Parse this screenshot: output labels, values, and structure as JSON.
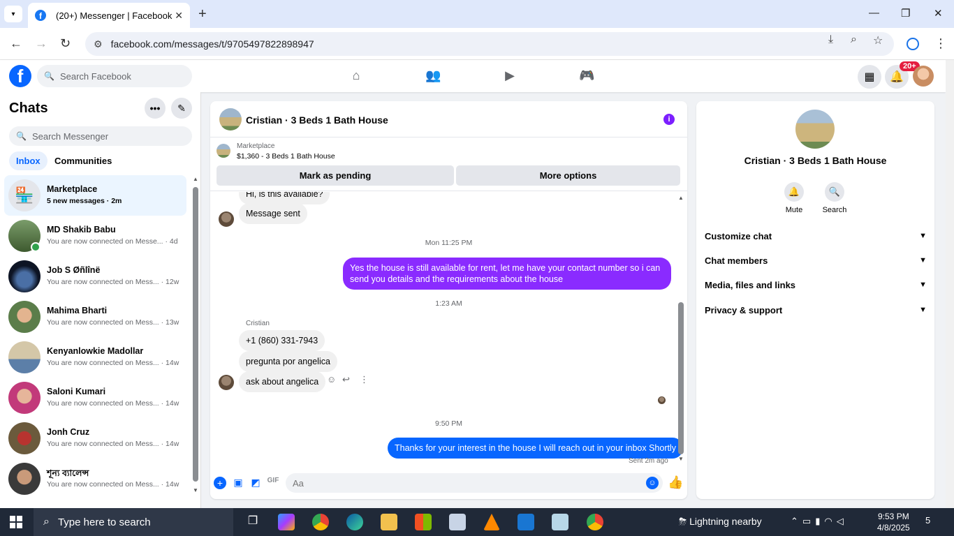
{
  "browser": {
    "tab_title": "(20+) Messenger | Facebook",
    "url": "facebook.com/messages/t/9705497822898947"
  },
  "header": {
    "search_placeholder": "Search Facebook",
    "notification_badge": "20+"
  },
  "sidebar": {
    "title": "Chats",
    "search_placeholder": "Search Messenger",
    "tabs": [
      "Inbox",
      "Communities"
    ],
    "chats": [
      {
        "name": "Marketplace",
        "preview": "5 new messages · 2m"
      },
      {
        "name": "MD Shakib Babu",
        "preview": "You are now connected on Messe... · 4d"
      },
      {
        "name": "Job S Øñlînë",
        "preview": "You are now connected on Mess... · 12w"
      },
      {
        "name": "Mahima Bharti",
        "preview": "You are now connected on Mess... · 13w"
      },
      {
        "name": "Kenyanlowkie Madollar",
        "preview": "You are now connected on Mess... · 14w"
      },
      {
        "name": "Saloni Kumari",
        "preview": "You are now connected on Mess... · 14w"
      },
      {
        "name": "Jonh Cruz",
        "preview": "You are now connected on Mess... · 14w"
      },
      {
        "name": "শূন্য ব্যালেন্স",
        "preview": "You are now connected on Mess... · 14w"
      }
    ]
  },
  "chat": {
    "title": "Cristian · 3 Beds 1 Bath House",
    "marketplace_label": "Marketplace",
    "listing": "$1,360 - 3 Beds 1 Bath House",
    "btn_pending": "Mark as pending",
    "btn_more": "More options",
    "messages": {
      "partial": "Hi, is this available?",
      "sent_notice": "Message sent",
      "ts1": "Mon 11:25 PM",
      "out1": "Yes the house is still available for rent, let me have your contact number so i can send you details and the requirements about the house",
      "ts2": "1:23 AM",
      "sender": "Cristian",
      "in1": "+1 (860) 331-7943",
      "in2": "pregunta por angelica",
      "in3": "ask about angelica",
      "ts3": "9:50 PM",
      "out2": "Thanks for your interest in the house I will reach out in your inbox Shortly",
      "status": "Sent 2m ago"
    },
    "composer_placeholder": "Aa"
  },
  "right_panel": {
    "name": "Cristian · 3 Beds 1 Bath House",
    "actions": [
      "Mute",
      "Search"
    ],
    "sections": [
      "Customize chat",
      "Chat members",
      "Media, files and links",
      "Privacy & support"
    ]
  },
  "taskbar": {
    "search_placeholder": "Type here to search",
    "weather": "Lightning nearby",
    "time": "9:53 PM",
    "date": "4/8/2025",
    "notifications": "5"
  },
  "colors": {
    "fb_blue": "#0866ff",
    "purple_bubble": "#8a2bff",
    "online": "#31a24c",
    "badge_red": "#e41e3f"
  }
}
